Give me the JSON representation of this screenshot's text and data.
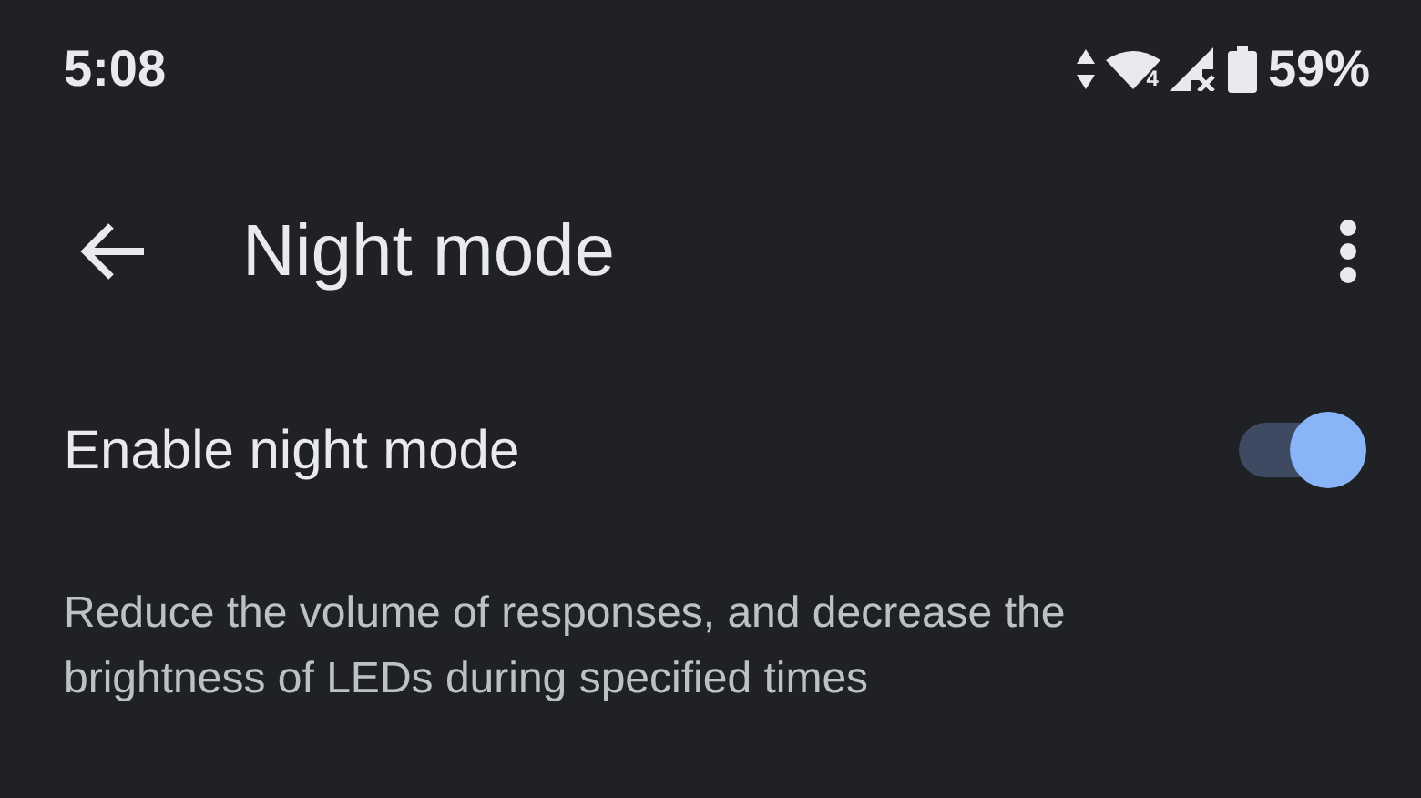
{
  "status_bar": {
    "time": "5:08",
    "wifi_badge": "4",
    "battery": "59%"
  },
  "app_bar": {
    "title": "Night mode"
  },
  "setting": {
    "label": "Enable night mode",
    "on": true
  },
  "description": "Reduce the volume of responses, and decrease the brightness of LEDs during specified times"
}
